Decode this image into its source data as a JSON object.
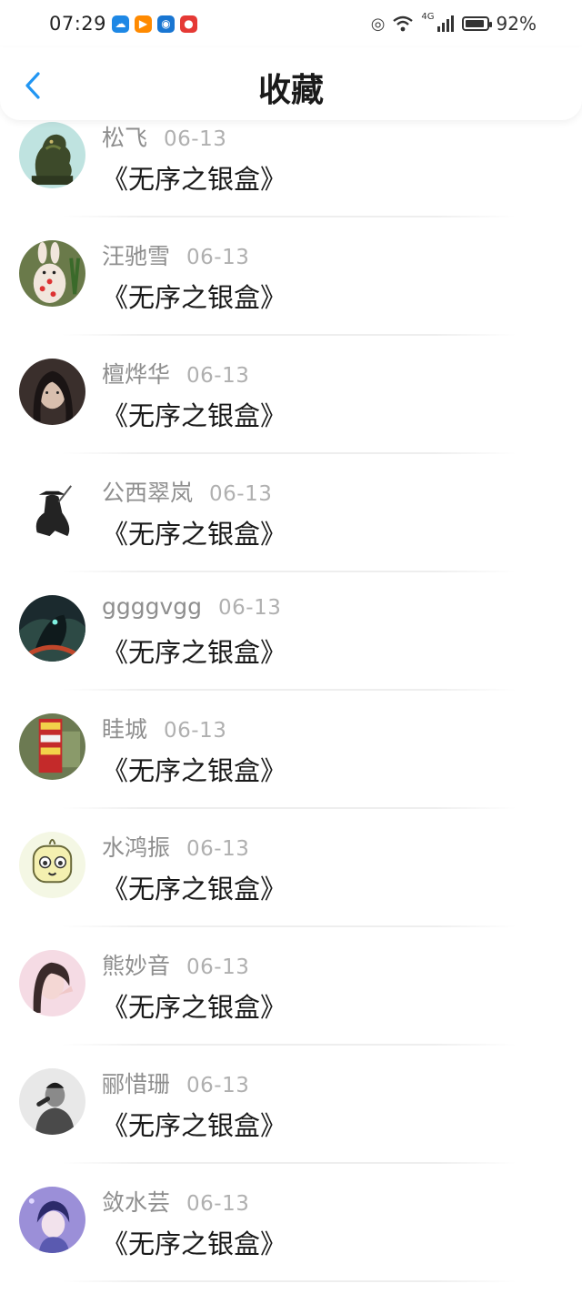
{
  "status_bar": {
    "time": "07:29",
    "network": "4G",
    "battery": "92%",
    "battery_level": 0.92
  },
  "header": {
    "title": "收藏",
    "back_icon": "chevron-left-icon",
    "accent_color": "#2196f3"
  },
  "items": [
    {
      "name": "松飞",
      "date": "06-13",
      "title": "《无序之银盒》",
      "avatar": "dragon-statue"
    },
    {
      "name": "汪驰雪",
      "date": "06-13",
      "title": "《无序之银盒》",
      "avatar": "rabbit-doll"
    },
    {
      "name": "檀烨华",
      "date": "06-13",
      "title": "《无序之银盒》",
      "avatar": "girl-portrait"
    },
    {
      "name": "公西翠岚",
      "date": "06-13",
      "title": "《无序之银盒》",
      "avatar": "cloaked-figure"
    },
    {
      "name": "ggggvgg",
      "date": "06-13",
      "title": "《无序之银盒》",
      "avatar": "game-warrior"
    },
    {
      "name": "眭城",
      "date": "06-13",
      "title": "《无序之银盒》",
      "avatar": "shop-sign"
    },
    {
      "name": "水鸿振",
      "date": "06-13",
      "title": "《无序之银盒》",
      "avatar": "cartoon-face"
    },
    {
      "name": "熊妙音",
      "date": "06-13",
      "title": "《无序之银盒》",
      "avatar": "pink-girl"
    },
    {
      "name": "郦惜珊",
      "date": "06-13",
      "title": "《无序之银盒》",
      "avatar": "bw-man"
    },
    {
      "name": "敛水芸",
      "date": "06-13",
      "title": "《无序之银盒》",
      "avatar": "anime-boy"
    }
  ]
}
